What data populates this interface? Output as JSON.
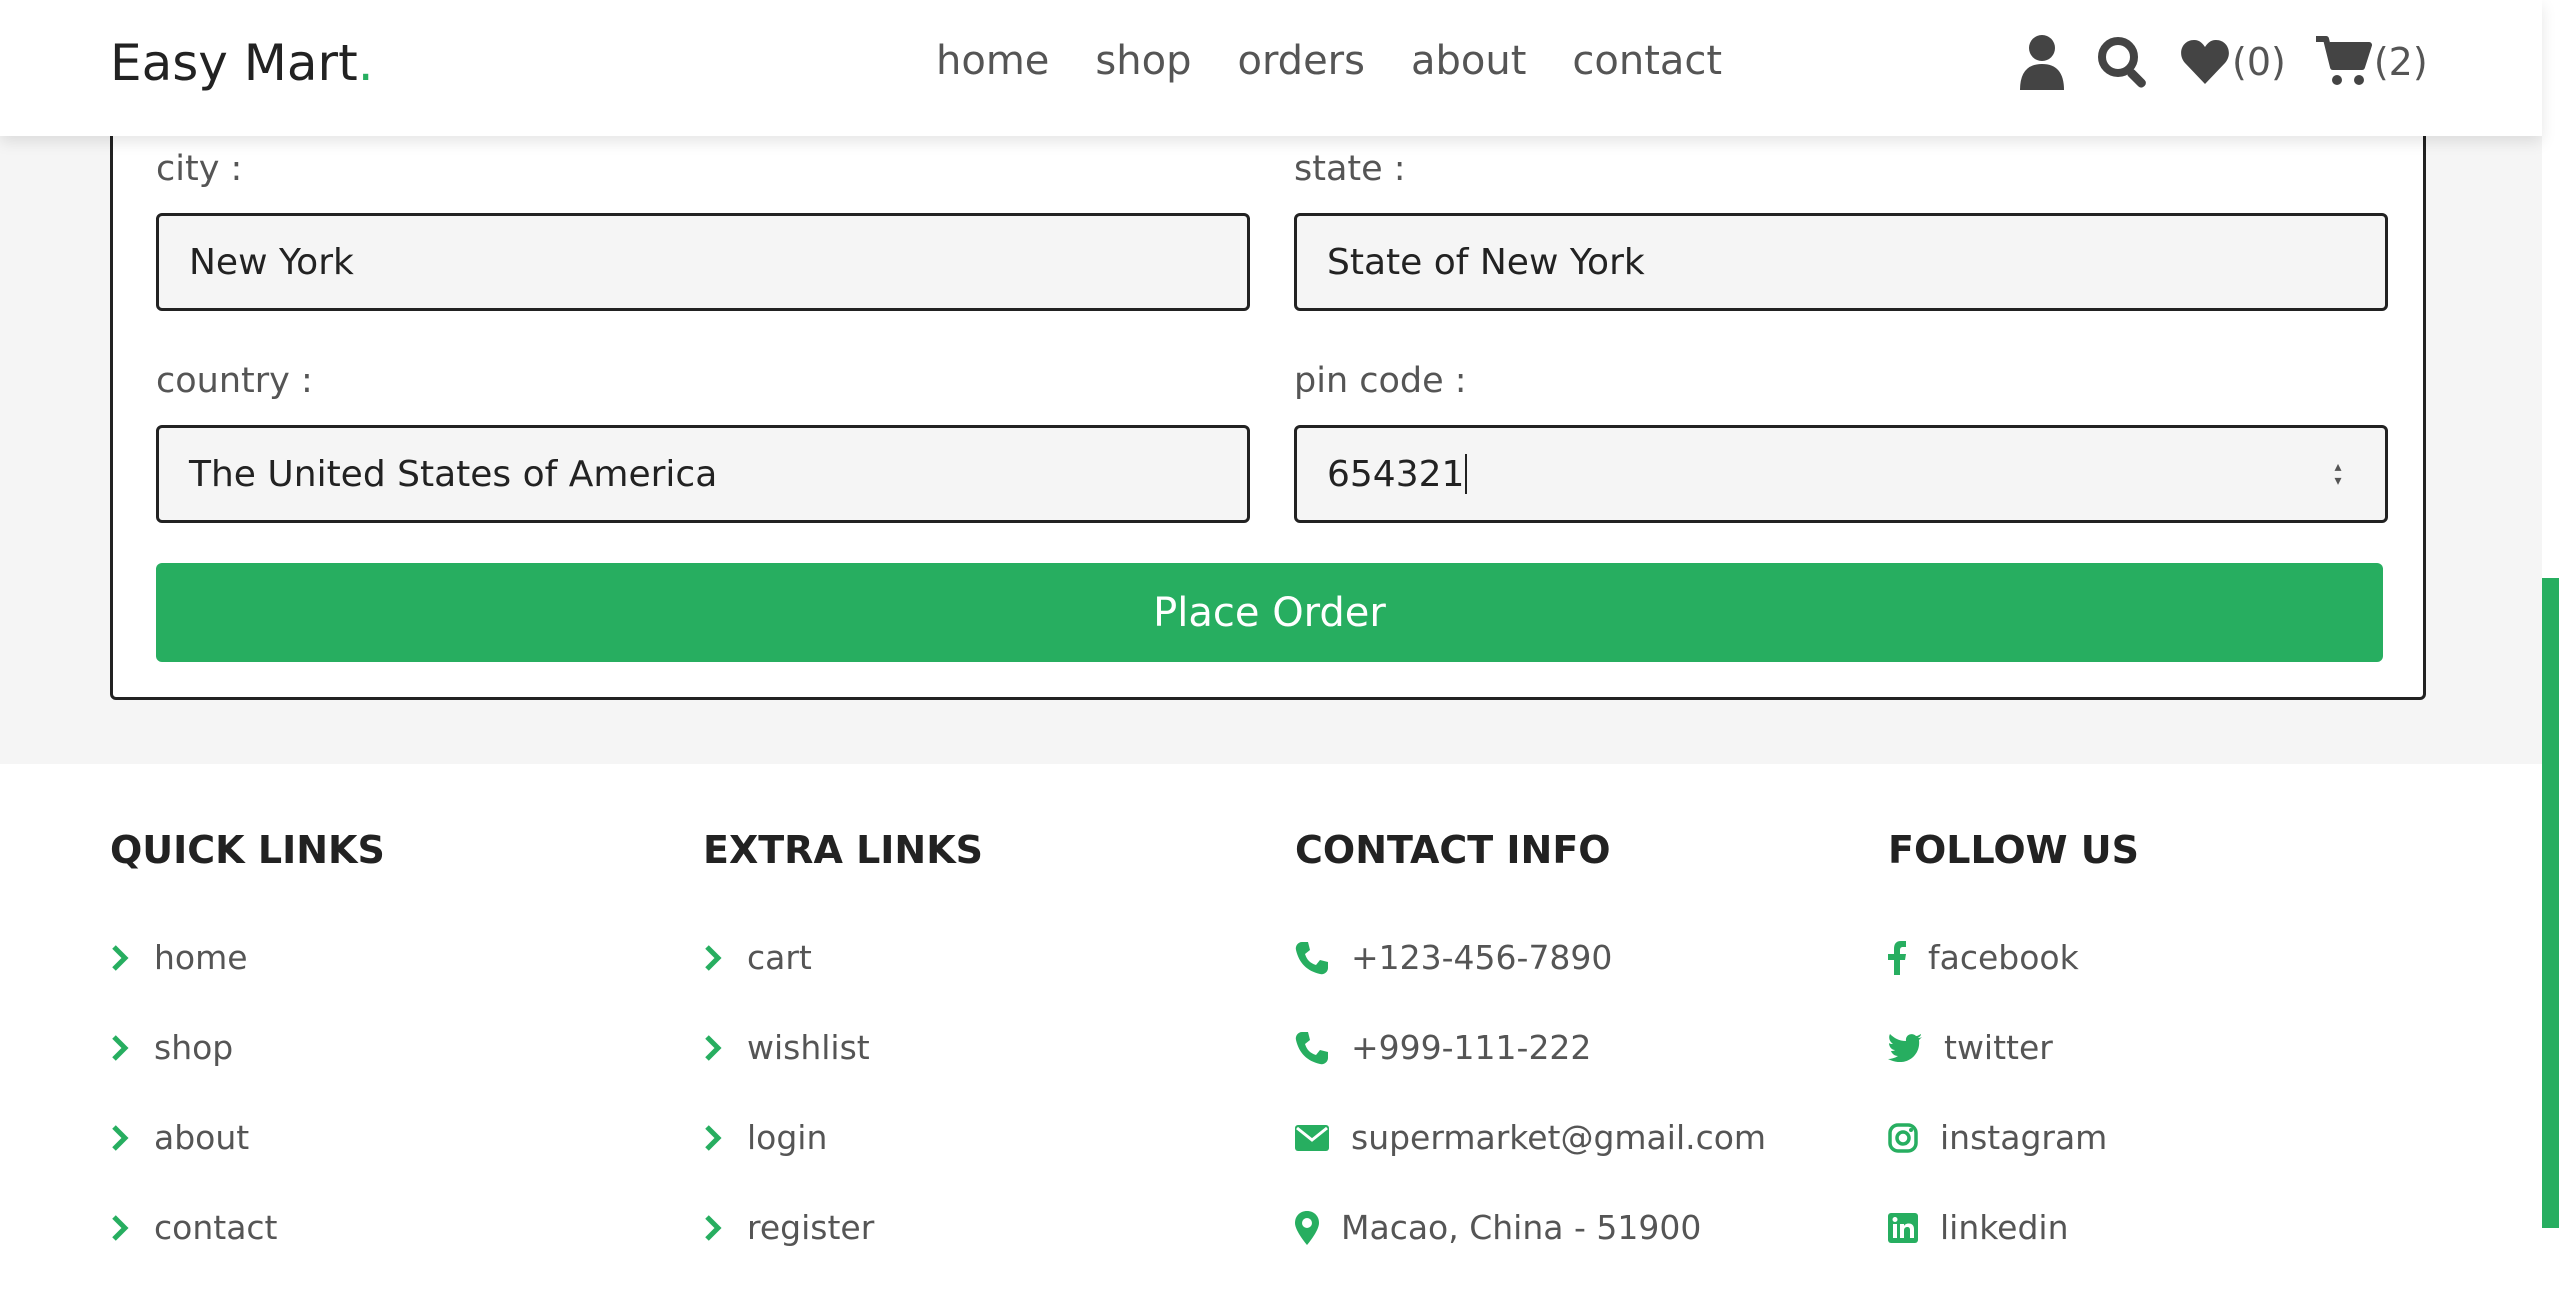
{
  "header": {
    "logo": "Easy Mart",
    "logo_dot": ".",
    "nav": [
      "home",
      "shop",
      "orders",
      "about",
      "contact"
    ],
    "icons": [
      "user-icon",
      "search-icon",
      "heart-icon",
      "cart-icon"
    ],
    "wishlist_count": "(0)",
    "cart_count": "(2)"
  },
  "form": {
    "city_label": "city :",
    "city_value": "New York",
    "state_label": "state :",
    "state_value": "State of New York",
    "country_label": "country :",
    "country_value": "The United States of America",
    "pin_label": "pin code :",
    "pin_value": "654321",
    "submit_label": "Place Order"
  },
  "footer": {
    "quick_links": {
      "title": "QUICK LINKS",
      "items": [
        "home",
        "shop",
        "about",
        "contact"
      ]
    },
    "extra_links": {
      "title": "EXTRA LINKS",
      "items": [
        "cart",
        "wishlist",
        "login",
        "register"
      ]
    },
    "contact_info": {
      "title": "CONTACT INFO",
      "items": [
        "+123-456-7890",
        "+999-111-222",
        "supermarket@gmail.com",
        "Macao, China - 51900"
      ]
    },
    "follow_us": {
      "title": "FOLLOW US",
      "items": [
        "facebook",
        "twitter",
        "instagram",
        "linkedin"
      ]
    }
  },
  "colors": {
    "accent": "#27ae60",
    "text": "#333333",
    "border": "#222222",
    "background": "#f5f5f5"
  }
}
